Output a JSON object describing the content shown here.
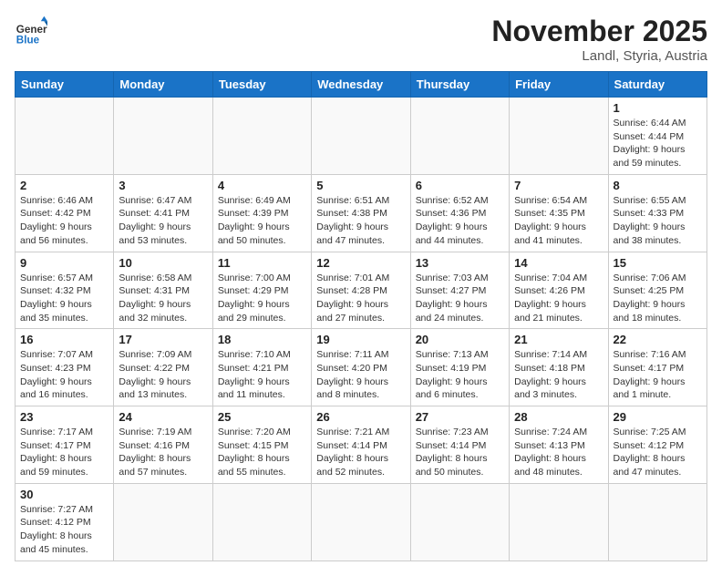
{
  "header": {
    "logo_general": "General",
    "logo_blue": "Blue",
    "month_title": "November 2025",
    "location": "Landl, Styria, Austria"
  },
  "weekdays": [
    "Sunday",
    "Monday",
    "Tuesday",
    "Wednesday",
    "Thursday",
    "Friday",
    "Saturday"
  ],
  "weeks": [
    [
      {
        "day": "",
        "info": ""
      },
      {
        "day": "",
        "info": ""
      },
      {
        "day": "",
        "info": ""
      },
      {
        "day": "",
        "info": ""
      },
      {
        "day": "",
        "info": ""
      },
      {
        "day": "",
        "info": ""
      },
      {
        "day": "1",
        "info": "Sunrise: 6:44 AM\nSunset: 4:44 PM\nDaylight: 9 hours and 59 minutes."
      }
    ],
    [
      {
        "day": "2",
        "info": "Sunrise: 6:46 AM\nSunset: 4:42 PM\nDaylight: 9 hours and 56 minutes."
      },
      {
        "day": "3",
        "info": "Sunrise: 6:47 AM\nSunset: 4:41 PM\nDaylight: 9 hours and 53 minutes."
      },
      {
        "day": "4",
        "info": "Sunrise: 6:49 AM\nSunset: 4:39 PM\nDaylight: 9 hours and 50 minutes."
      },
      {
        "day": "5",
        "info": "Sunrise: 6:51 AM\nSunset: 4:38 PM\nDaylight: 9 hours and 47 minutes."
      },
      {
        "day": "6",
        "info": "Sunrise: 6:52 AM\nSunset: 4:36 PM\nDaylight: 9 hours and 44 minutes."
      },
      {
        "day": "7",
        "info": "Sunrise: 6:54 AM\nSunset: 4:35 PM\nDaylight: 9 hours and 41 minutes."
      },
      {
        "day": "8",
        "info": "Sunrise: 6:55 AM\nSunset: 4:33 PM\nDaylight: 9 hours and 38 minutes."
      }
    ],
    [
      {
        "day": "9",
        "info": "Sunrise: 6:57 AM\nSunset: 4:32 PM\nDaylight: 9 hours and 35 minutes."
      },
      {
        "day": "10",
        "info": "Sunrise: 6:58 AM\nSunset: 4:31 PM\nDaylight: 9 hours and 32 minutes."
      },
      {
        "day": "11",
        "info": "Sunrise: 7:00 AM\nSunset: 4:29 PM\nDaylight: 9 hours and 29 minutes."
      },
      {
        "day": "12",
        "info": "Sunrise: 7:01 AM\nSunset: 4:28 PM\nDaylight: 9 hours and 27 minutes."
      },
      {
        "day": "13",
        "info": "Sunrise: 7:03 AM\nSunset: 4:27 PM\nDaylight: 9 hours and 24 minutes."
      },
      {
        "day": "14",
        "info": "Sunrise: 7:04 AM\nSunset: 4:26 PM\nDaylight: 9 hours and 21 minutes."
      },
      {
        "day": "15",
        "info": "Sunrise: 7:06 AM\nSunset: 4:25 PM\nDaylight: 9 hours and 18 minutes."
      }
    ],
    [
      {
        "day": "16",
        "info": "Sunrise: 7:07 AM\nSunset: 4:23 PM\nDaylight: 9 hours and 16 minutes."
      },
      {
        "day": "17",
        "info": "Sunrise: 7:09 AM\nSunset: 4:22 PM\nDaylight: 9 hours and 13 minutes."
      },
      {
        "day": "18",
        "info": "Sunrise: 7:10 AM\nSunset: 4:21 PM\nDaylight: 9 hours and 11 minutes."
      },
      {
        "day": "19",
        "info": "Sunrise: 7:11 AM\nSunset: 4:20 PM\nDaylight: 9 hours and 8 minutes."
      },
      {
        "day": "20",
        "info": "Sunrise: 7:13 AM\nSunset: 4:19 PM\nDaylight: 9 hours and 6 minutes."
      },
      {
        "day": "21",
        "info": "Sunrise: 7:14 AM\nSunset: 4:18 PM\nDaylight: 9 hours and 3 minutes."
      },
      {
        "day": "22",
        "info": "Sunrise: 7:16 AM\nSunset: 4:17 PM\nDaylight: 9 hours and 1 minute."
      }
    ],
    [
      {
        "day": "23",
        "info": "Sunrise: 7:17 AM\nSunset: 4:17 PM\nDaylight: 8 hours and 59 minutes."
      },
      {
        "day": "24",
        "info": "Sunrise: 7:19 AM\nSunset: 4:16 PM\nDaylight: 8 hours and 57 minutes."
      },
      {
        "day": "25",
        "info": "Sunrise: 7:20 AM\nSunset: 4:15 PM\nDaylight: 8 hours and 55 minutes."
      },
      {
        "day": "26",
        "info": "Sunrise: 7:21 AM\nSunset: 4:14 PM\nDaylight: 8 hours and 52 minutes."
      },
      {
        "day": "27",
        "info": "Sunrise: 7:23 AM\nSunset: 4:14 PM\nDaylight: 8 hours and 50 minutes."
      },
      {
        "day": "28",
        "info": "Sunrise: 7:24 AM\nSunset: 4:13 PM\nDaylight: 8 hours and 48 minutes."
      },
      {
        "day": "29",
        "info": "Sunrise: 7:25 AM\nSunset: 4:12 PM\nDaylight: 8 hours and 47 minutes."
      }
    ],
    [
      {
        "day": "30",
        "info": "Sunrise: 7:27 AM\nSunset: 4:12 PM\nDaylight: 8 hours and 45 minutes."
      },
      {
        "day": "",
        "info": ""
      },
      {
        "day": "",
        "info": ""
      },
      {
        "day": "",
        "info": ""
      },
      {
        "day": "",
        "info": ""
      },
      {
        "day": "",
        "info": ""
      },
      {
        "day": "",
        "info": ""
      }
    ]
  ]
}
